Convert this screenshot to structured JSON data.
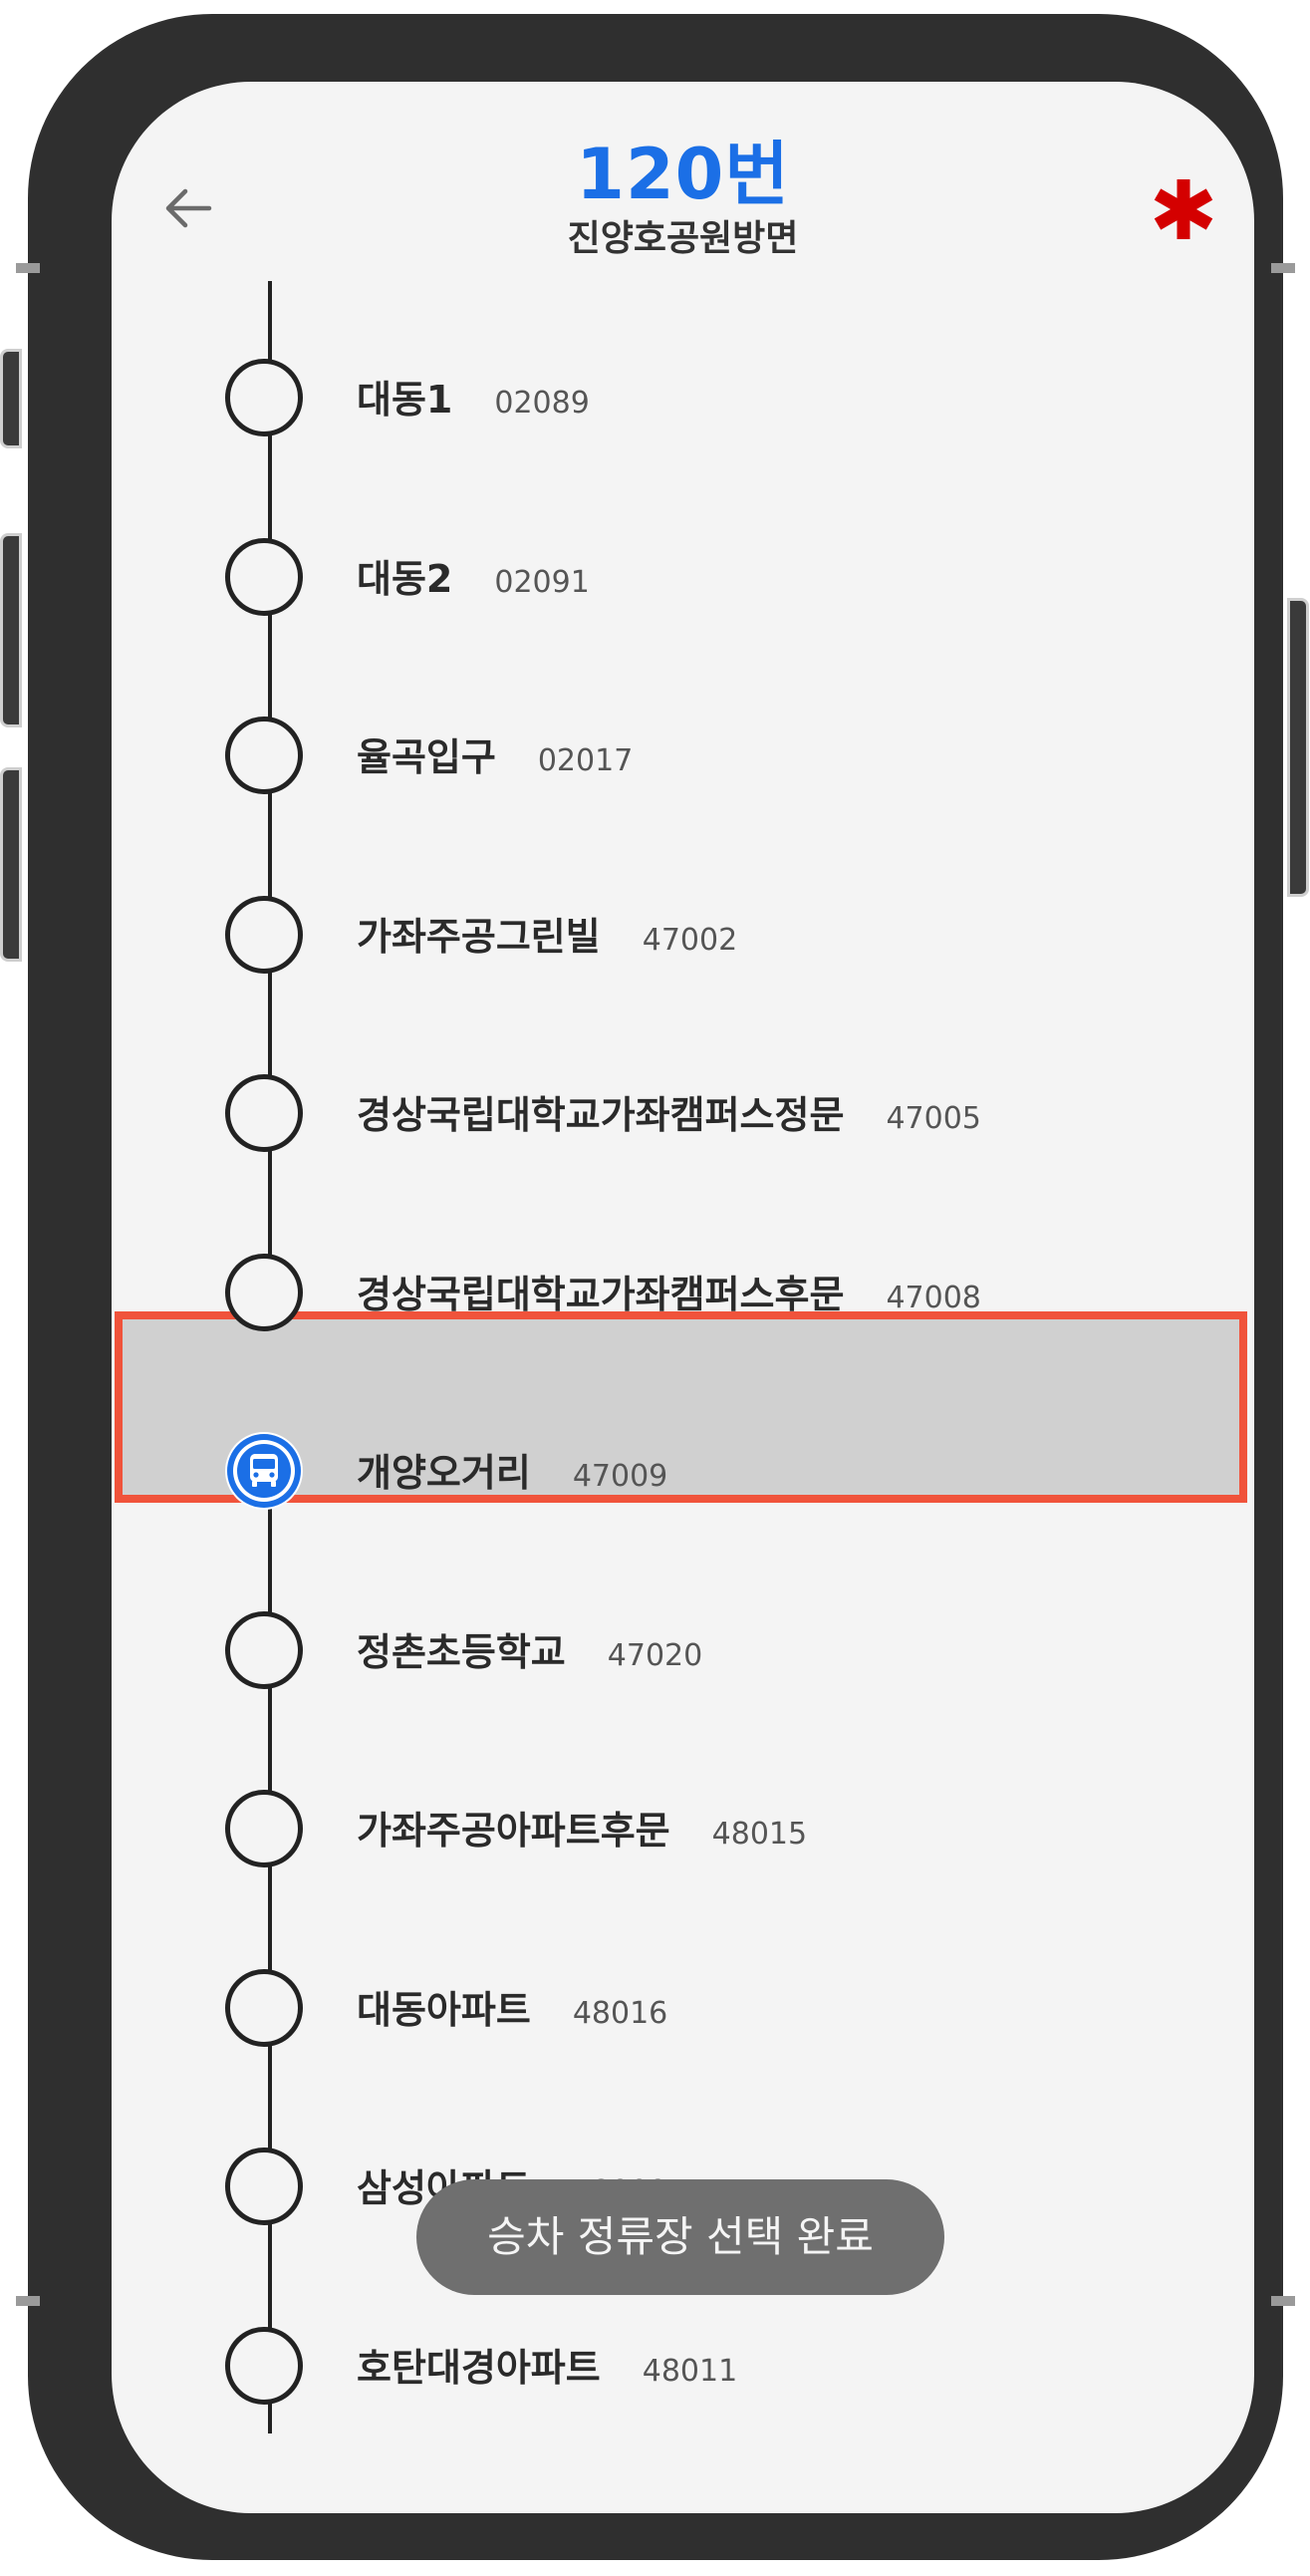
{
  "header": {
    "route_number": "120번",
    "direction": "진양호공원방면",
    "back_icon": "arrow-left-icon",
    "action_icon": "asterisk-icon",
    "route_color": "#1b6fe6",
    "action_color": "#d40000"
  },
  "stops": [
    {
      "name": "대동1",
      "code": "02089"
    },
    {
      "name": "대동2",
      "code": "02091"
    },
    {
      "name": "율곡입구",
      "code": "02017"
    },
    {
      "name": "가좌주공그린빌",
      "code": "47002"
    },
    {
      "name": "경상국립대학교가좌캠퍼스정문",
      "code": "47005"
    },
    {
      "name": "경상국립대학교가좌캠퍼스후문",
      "code": "47008"
    },
    {
      "name": "개양오거리",
      "code": "47009",
      "selected": true
    },
    {
      "name": "정촌초등학교",
      "code": "47020"
    },
    {
      "name": "가좌주공아파트후문",
      "code": "48015"
    },
    {
      "name": "대동아파트",
      "code": "48016"
    },
    {
      "name": "삼성아파트",
      "code": "48009"
    },
    {
      "name": "호탄대경아파트",
      "code": "48011"
    }
  ],
  "selected_stop_index": 6,
  "highlight_border_color": "#f0533b",
  "toast": {
    "text": "승차 정류장 선택 완료"
  }
}
